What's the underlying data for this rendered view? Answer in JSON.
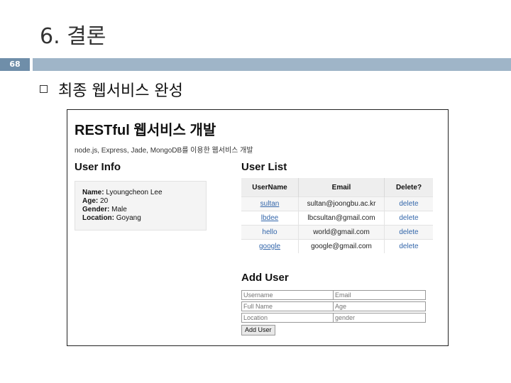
{
  "slide": {
    "title": "6. 결론",
    "number": "68",
    "bullet": "최종 웹서비스 완성"
  },
  "app": {
    "title": "RESTful 웹서비스 개발",
    "subtitle": "node.js, Express, Jade, MongoDB를 이용한 웹서비스 개발",
    "user_info": {
      "heading": "User Info",
      "rows": [
        {
          "label": "Name:",
          "value": "Lyoungcheon Lee"
        },
        {
          "label": "Age:",
          "value": "20"
        },
        {
          "label": "Gender:",
          "value": "Male"
        },
        {
          "label": "Location:",
          "value": "Goyang"
        }
      ]
    },
    "user_list": {
      "heading": "User List",
      "columns": [
        "UserName",
        "Email",
        "Delete?"
      ],
      "rows": [
        {
          "username": "sultan",
          "email": "sultan@joongbu.ac.kr",
          "delete": "delete"
        },
        {
          "username": "lbdee",
          "email": "lbcsultan@gmail.com",
          "delete": "delete"
        },
        {
          "username": "hello",
          "email": "world@gmail.com",
          "delete": "delete"
        },
        {
          "username": "google",
          "email": "google@gmail.com",
          "delete": "delete"
        }
      ]
    },
    "add_user": {
      "heading": "Add User",
      "placeholders": {
        "username": "Username",
        "email": "Email",
        "fullname": "Full Name",
        "age": "Age",
        "location": "Location",
        "gender": "gender"
      },
      "button": "Add User"
    }
  },
  "colors": {
    "slide_number_bg": "#6f8ea9",
    "title_rule": "#9fb5c8",
    "link": "#3366aa"
  }
}
